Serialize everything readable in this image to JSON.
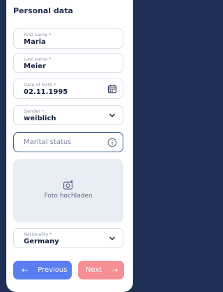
{
  "section_title": "Personal data",
  "fields": {
    "first_name": {
      "label": "First name *",
      "value": "Maria"
    },
    "last_name": {
      "label": "Last name *",
      "value": "Meier"
    },
    "dob": {
      "label": "Date of birth *",
      "value": "02.11.1995",
      "icon": "calendar-icon"
    },
    "gender": {
      "label": "Gender *",
      "value": "weiblich",
      "icon": "chevron-down-icon"
    },
    "marital": {
      "placeholder": "Marital status",
      "icon": "info-icon"
    },
    "nationality": {
      "label": "Nationality *",
      "value": "Germany",
      "icon": "chevron-down-icon"
    }
  },
  "upload": {
    "label": "Foto hochladen",
    "icon": "camera-icon"
  },
  "buttons": {
    "previous": "Previous",
    "next": "Next"
  },
  "colors": {
    "accent": "#5a7df0",
    "next_button": "#f58f94",
    "background": "#1f2f56"
  }
}
